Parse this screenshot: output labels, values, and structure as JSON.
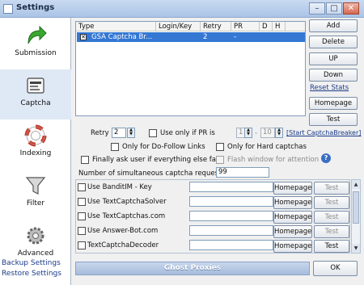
{
  "window": {
    "title": "Settings",
    "controls": {
      "minimize": "–",
      "maximize": "□",
      "close": "✕"
    }
  },
  "sidebar": {
    "items": [
      {
        "label": "Submission",
        "icon": "green-arrow-icon"
      },
      {
        "label": "Captcha",
        "icon": "captcha-icon"
      },
      {
        "label": "Indexing",
        "icon": "lifebuoy-icon"
      },
      {
        "label": "Filter",
        "icon": "funnel-icon"
      },
      {
        "label": "Advanced",
        "icon": "gear-icon"
      }
    ],
    "backup_label": "Backup Settings",
    "restore_label": "Restore Settings"
  },
  "table": {
    "columns": [
      "Type",
      "Login/Key",
      "Retry",
      "PR",
      "D",
      "H"
    ],
    "rows": [
      {
        "type": "GSA Captcha Br...",
        "login": "",
        "retry": "2",
        "pr": "-",
        "d": "",
        "h": "",
        "checked_mark": "✕"
      }
    ]
  },
  "right_buttons": {
    "add": "Add",
    "delete": "Delete",
    "up": "UP",
    "down": "Down",
    "reset_stats": "Reset Stats",
    "homepage": "Homepage",
    "test": "Test"
  },
  "options": {
    "retry_label": "Retry",
    "retry_value": "2",
    "use_only_pr_label": "Use only if PR is",
    "pr_from": "1",
    "pr_sep": "-",
    "pr_to": "10",
    "start_link": "[Start CaptchaBreaker]",
    "only_dofollow": "Only for Do-Follow Links",
    "only_hard": "Only for Hard captchas",
    "finally_ask": "Finally ask user if everything else fails",
    "flash_window": "Flash window for attention",
    "simultaneous_label": "Number of simultaneous captcha requests",
    "simultaneous_value": "99"
  },
  "solvers": [
    {
      "label": "Use BanditIM - Key",
      "value": "",
      "homepage": "Homepage",
      "test": "Test"
    },
    {
      "label": "Use TextCaptchaSolver",
      "value": "",
      "homepage": "Homepage",
      "test": "Test"
    },
    {
      "label": "Use TextCaptchas.com",
      "value": "",
      "homepage": "Homepage",
      "test": "Test"
    },
    {
      "label": "Use Answer-Bot.com",
      "value": "",
      "homepage": "Homepage",
      "test": "Test"
    },
    {
      "label": "TextCaptchaDecoder",
      "value": "",
      "homepage": "Homepage",
      "test": "Test"
    }
  ],
  "bottom": {
    "ghost_proxies": "Ghost Proxies",
    "ok": "OK"
  }
}
